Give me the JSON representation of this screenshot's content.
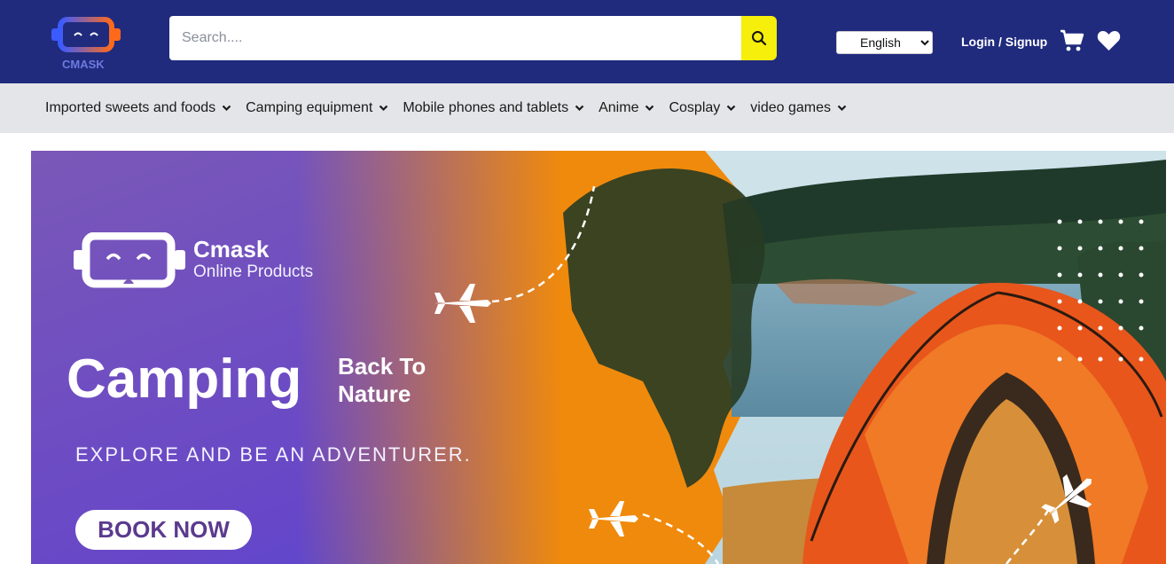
{
  "header": {
    "logo_text": "CMASK",
    "search": {
      "placeholder": "Search....",
      "value": ""
    },
    "language": {
      "selected": "English",
      "options": [
        "English"
      ]
    },
    "login_label": "Login / Signup",
    "icons": {
      "search": "search-icon",
      "cart": "cart-icon",
      "wishlist": "heart-icon"
    },
    "colors": {
      "background": "#202b7e",
      "search_button": "#f6ee0b"
    }
  },
  "categories": [
    {
      "label": "Imported sweets and foods"
    },
    {
      "label": "Camping equipment"
    },
    {
      "label": "Mobile phones and tablets"
    },
    {
      "label": "Anime"
    },
    {
      "label": "Cosplay"
    },
    {
      "label": "video games"
    }
  ],
  "banner": {
    "brand_name": "Cmask",
    "brand_sub": "Online Products",
    "headline": "Camping",
    "headline_side_1": "Back To",
    "headline_side_2": "Nature",
    "tagline": "EXPLORE AND BE AN ADVENTURER.",
    "cta_label": "BOOK NOW",
    "colors": {
      "purple": "#6a4bc4",
      "orange": "#f08a0c",
      "tent": "#e8561c"
    }
  }
}
